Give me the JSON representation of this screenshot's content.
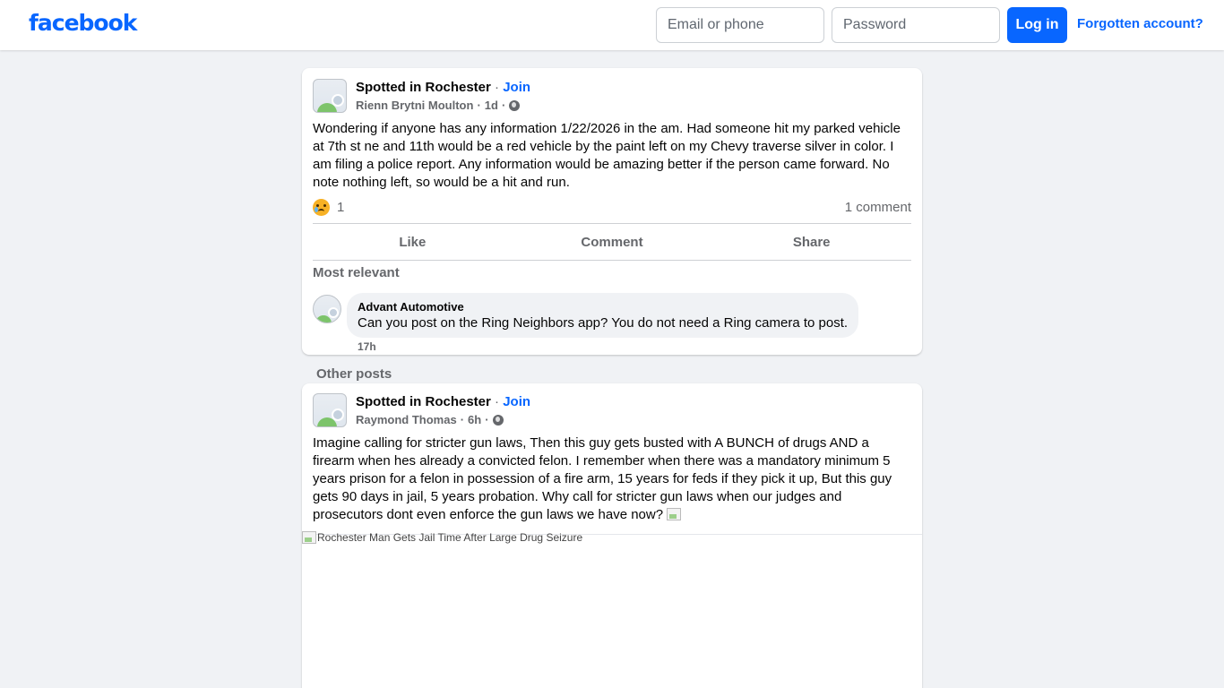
{
  "header": {
    "logo": "facebook",
    "email_placeholder": "Email or phone",
    "password_placeholder": "Password",
    "login_label": "Log in",
    "forgot_label": "Forgotten account?"
  },
  "post1": {
    "group": "Spotted in Rochester",
    "separator": "·",
    "join": "Join",
    "author": "Rienn Brytni Moulton",
    "time": "1d",
    "text": "Wondering if anyone has any information 1/22/2026 in the am. Had someone hit my parked vehicle at 7th st ne and 11th would be a red vehicle by the paint left on my Chevy traverse silver in color. I am filing a police report. Any information would be amazing better if the person came forward. No note nothing left, so would be a hit and run.",
    "reaction_count": "1",
    "comment_count": "1 comment",
    "actions": {
      "like": "Like",
      "comment": "Comment",
      "share": "Share"
    },
    "sort_label": "Most relevant",
    "comment": {
      "author": "Advant Automotive",
      "text": "Can you post on the Ring Neighbors app? You do not need a Ring camera to post.",
      "time": "17h"
    }
  },
  "other_posts_label": "Other posts",
  "post2": {
    "group": "Spotted in Rochester",
    "separator": "·",
    "join": "Join",
    "author": "Raymond Thomas",
    "time": "6h",
    "text": "Imagine calling for stricter gun laws, Then this guy gets busted with A BUNCH of drugs AND a firearm when hes already a convicted felon. I remember when there was a mandatory minimum 5 years prison for a felon in possession of a fire arm, 15 years for feds if they pick it up, But this guy gets 90 days in jail, 5 years probation. Why call for stricter gun laws when our judges and prosecutors dont even enforce the gun laws we have now?",
    "image_alt": "Rochester Man Gets Jail Time After Large Drug Seizure"
  },
  "colors": {
    "brand": "#0866ff",
    "background": "#f0f2f5",
    "secondary_text": "#65676b"
  }
}
